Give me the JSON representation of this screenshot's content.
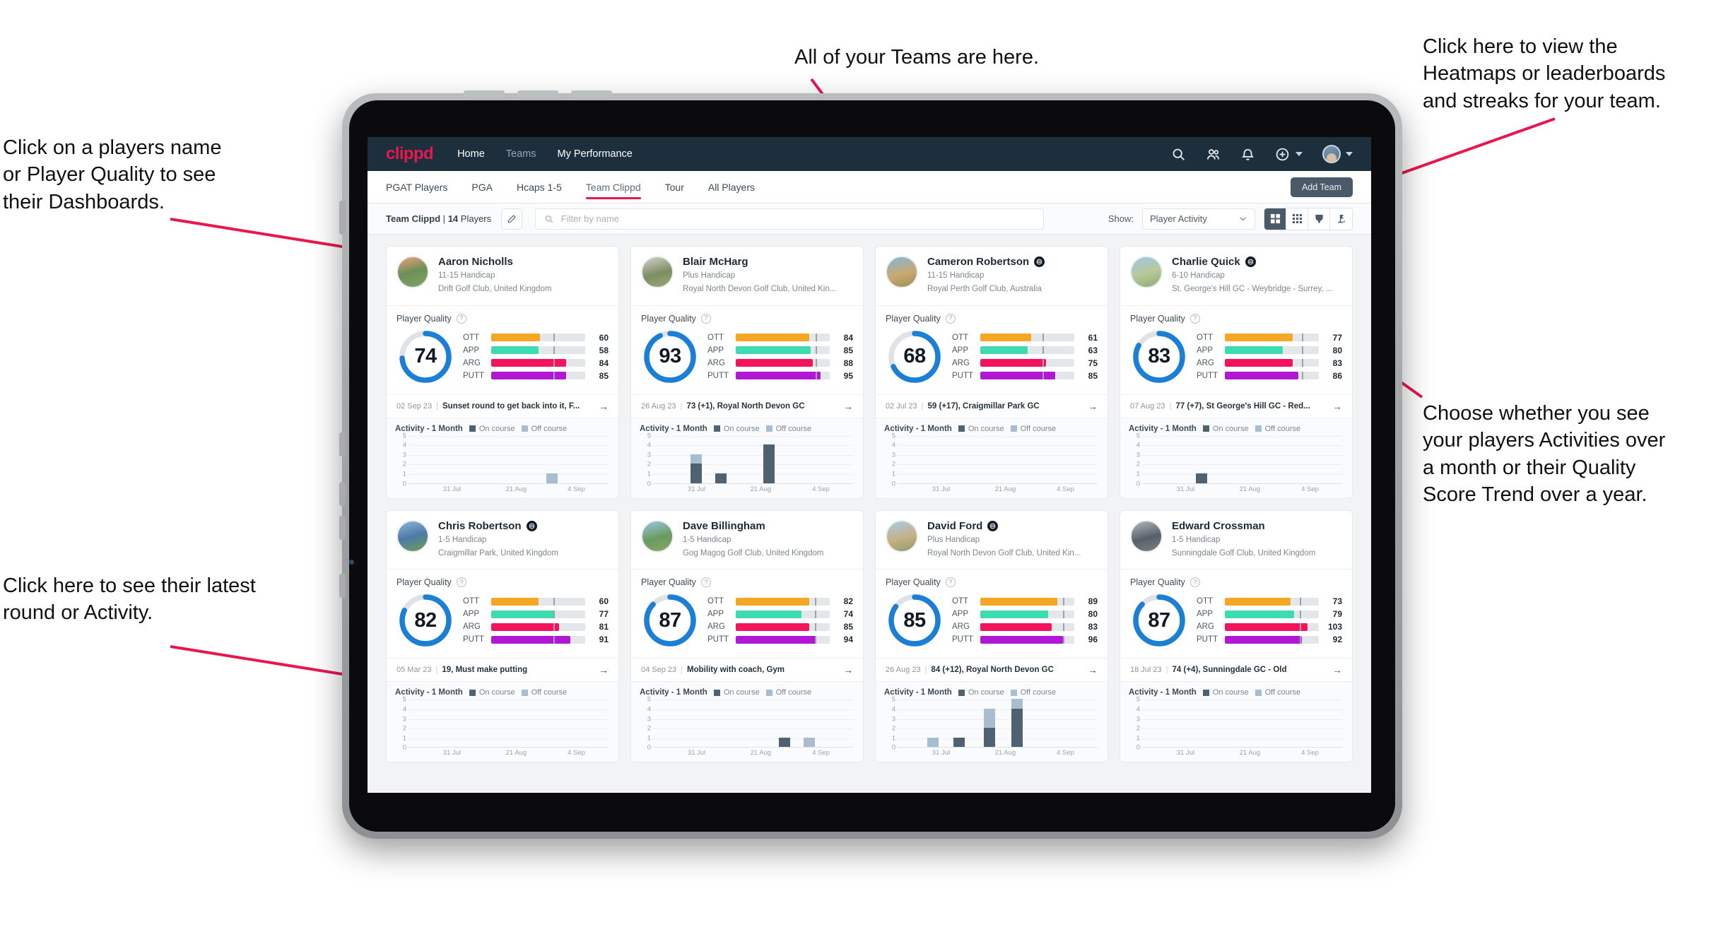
{
  "annotations": [
    {
      "id": "a-teams",
      "text": "All of your Teams are here."
    },
    {
      "id": "a-heatmaps",
      "text": "Click here to view the\nHeatmaps or leaderboards\nand streaks for your team."
    },
    {
      "id": "a-names",
      "text": "Click on a players name\nor Player Quality to see\ntheir Dashboards."
    },
    {
      "id": "a-choose",
      "text": "Choose whether you see\nyour players Activities over\na month or their Quality\nScore Trend over a year."
    },
    {
      "id": "a-latest",
      "text": "Click here to see their latest\nround or Activity."
    }
  ],
  "navbar": {
    "logo": "clippd",
    "links": [
      {
        "label": "Home",
        "active": true
      },
      {
        "label": "Teams",
        "active": false
      },
      {
        "label": "My Performance",
        "active": true
      }
    ],
    "icons": [
      "search-icon",
      "people-icon",
      "bell-icon",
      "plus-circle-icon",
      "chevron-down-icon",
      "avatar"
    ]
  },
  "tabs": [
    {
      "label": "PGAT Players",
      "active": false
    },
    {
      "label": "PGA",
      "active": false
    },
    {
      "label": "Hcaps 1-5",
      "active": false
    },
    {
      "label": "Team Clippd",
      "active": true
    },
    {
      "label": "Tour",
      "active": false
    },
    {
      "label": "All Players",
      "active": false
    }
  ],
  "toolbar": {
    "add_team_label": "Add Team",
    "team_name": "Team Clippd",
    "team_divider": "|",
    "player_count": "14",
    "players_word": "Players",
    "edit_icon": "pencil-icon",
    "search_placeholder": "Filter by name",
    "search_value": "",
    "show_label": "Show:",
    "show_value": "Player Activity",
    "views": [
      {
        "name": "grid-large-view",
        "icon": "grid-4-icon",
        "active": true
      },
      {
        "name": "grid-dense-view",
        "icon": "grid-9-icon",
        "active": false
      },
      {
        "name": "leaderboard-view",
        "icon": "trophy-icon",
        "active": false
      },
      {
        "name": "heatmap-view",
        "icon": "flag-pin-icon",
        "active": false
      }
    ]
  },
  "quality": {
    "title": "Player Quality",
    "help_icon": "question-icon",
    "metric_labels": [
      "OTT",
      "APP",
      "ARG",
      "PUTT"
    ],
    "colors": {
      "OTT": "#f5a623",
      "APP": "#3ddbb0",
      "ARG": "#f4145e",
      "PUTT": "#b317d6",
      "gauge": "#1c7fd6",
      "track": "#e4e7ea"
    }
  },
  "activity": {
    "title": "Activity - 1 Month",
    "legend": [
      {
        "label": "On course",
        "color": "#4f6272"
      },
      {
        "label": "Off course",
        "color": "#a9bdd0"
      }
    ],
    "y_ticks": [
      5,
      4,
      3,
      2,
      1,
      0
    ],
    "x_ticks": [
      "31 Jul",
      "21 Aug",
      "4 Sep"
    ],
    "ymax": 5
  },
  "players": [
    {
      "name": "Aaron Nicholls",
      "verified": false,
      "handicap": "11-15 Handicap",
      "club": "Drift Golf Club, United Kingdom",
      "quality_score": 74,
      "metrics": [
        {
          "label": "OTT",
          "value": 60,
          "fill": 52,
          "tick": 66
        },
        {
          "label": "APP",
          "value": 58,
          "fill": 50,
          "tick": 66
        },
        {
          "label": "ARG",
          "value": 84,
          "fill": 80,
          "tick": 66
        },
        {
          "label": "PUTT",
          "value": 85,
          "fill": 80,
          "tick": 66
        }
      ],
      "latest": {
        "date": "02 Sep 23",
        "text": "Sunset round to get back into it, F..."
      },
      "chart_data": {
        "type": "bar",
        "stacked": true,
        "categories": [
          "31 Jul",
          "21 Aug",
          "4 Sep"
        ],
        "series": [
          {
            "name": "On course",
            "values": [
              0,
              0,
              0
            ]
          },
          {
            "name": "Off course",
            "values": [
              0,
              0,
              1
            ]
          }
        ],
        "bars": [
          {
            "pos": 0.72,
            "on": 0,
            "off": 1
          }
        ],
        "ylim": [
          0,
          5
        ]
      }
    },
    {
      "name": "Blair McHarg",
      "verified": false,
      "handicap": "Plus Handicap",
      "club": "Royal North Devon Golf Club, United Kin...",
      "quality_score": 93,
      "metrics": [
        {
          "label": "OTT",
          "value": 84,
          "fill": 78,
          "tick": 85
        },
        {
          "label": "APP",
          "value": 85,
          "fill": 80,
          "tick": 85
        },
        {
          "label": "ARG",
          "value": 88,
          "fill": 82,
          "tick": 85
        },
        {
          "label": "PUTT",
          "value": 95,
          "fill": 90,
          "tick": 85
        }
      ],
      "latest": {
        "date": "26 Aug 23",
        "text": "73 (+1), Royal North Devon GC"
      },
      "chart_data": {
        "type": "bar",
        "stacked": true,
        "categories": [
          "31 Jul",
          "21 Aug",
          "4 Sep"
        ],
        "series": [
          {
            "name": "On course",
            "values": [
              2,
              1,
              4
            ]
          },
          {
            "name": "Off course",
            "values": [
              1,
              0,
              0
            ]
          }
        ],
        "bars": [
          {
            "pos": 0.22,
            "on": 2,
            "off": 1
          },
          {
            "pos": 0.34,
            "on": 1,
            "off": 0
          },
          {
            "pos": 0.58,
            "on": 4,
            "off": 0
          }
        ],
        "ylim": [
          0,
          5
        ]
      }
    },
    {
      "name": "Cameron Robertson",
      "verified": true,
      "handicap": "11-15 Handicap",
      "club": "Royal Perth Golf Club, Australia",
      "quality_score": 68,
      "metrics": [
        {
          "label": "OTT",
          "value": 61,
          "fill": 54,
          "tick": 66
        },
        {
          "label": "APP",
          "value": 63,
          "fill": 50,
          "tick": 66
        },
        {
          "label": "ARG",
          "value": 75,
          "fill": 70,
          "tick": 66
        },
        {
          "label": "PUTT",
          "value": 85,
          "fill": 80,
          "tick": 66
        }
      ],
      "latest": {
        "date": "02 Jul 23",
        "text": "59 (+17), Craigmillar Park GC"
      },
      "chart_data": {
        "type": "bar",
        "stacked": true,
        "categories": [
          "31 Jul",
          "21 Aug",
          "4 Sep"
        ],
        "series": [
          {
            "name": "On course",
            "values": [
              0,
              0,
              0
            ]
          },
          {
            "name": "Off course",
            "values": [
              0,
              0,
              0
            ]
          }
        ],
        "bars": [],
        "ylim": [
          0,
          5
        ]
      }
    },
    {
      "name": "Charlie Quick",
      "verified": true,
      "handicap": "6-10 Handicap",
      "club": "St. George's Hill GC - Weybridge - Surrey, ...",
      "quality_score": 83,
      "metrics": [
        {
          "label": "OTT",
          "value": 77,
          "fill": 72,
          "tick": 82
        },
        {
          "label": "APP",
          "value": 80,
          "fill": 62,
          "tick": 82
        },
        {
          "label": "ARG",
          "value": 83,
          "fill": 72,
          "tick": 82
        },
        {
          "label": "PUTT",
          "value": 86,
          "fill": 78,
          "tick": 82
        }
      ],
      "latest": {
        "date": "07 Aug 23",
        "text": "77 (+7), St George's Hill GC - Red..."
      },
      "chart_data": {
        "type": "bar",
        "stacked": true,
        "categories": [
          "31 Jul",
          "21 Aug",
          "4 Sep"
        ],
        "series": [
          {
            "name": "On course",
            "values": [
              1,
              0,
              0
            ]
          },
          {
            "name": "Off course",
            "values": [
              0,
              0,
              0
            ]
          }
        ],
        "bars": [
          {
            "pos": 0.3,
            "on": 1,
            "off": 0
          }
        ],
        "ylim": [
          0,
          5
        ]
      }
    },
    {
      "name": "Chris Robertson",
      "verified": true,
      "handicap": "1-5 Handicap",
      "club": "Craigmillar Park, United Kingdom",
      "quality_score": 82,
      "metrics": [
        {
          "label": "OTT",
          "value": 60,
          "fill": 50,
          "tick": 66
        },
        {
          "label": "APP",
          "value": 77,
          "fill": 68,
          "tick": 66
        },
        {
          "label": "ARG",
          "value": 81,
          "fill": 72,
          "tick": 66
        },
        {
          "label": "PUTT",
          "value": 91,
          "fill": 84,
          "tick": 66
        }
      ],
      "latest": {
        "date": "05 Mar 23",
        "text": "19, Must make putting"
      },
      "chart_data": {
        "type": "bar",
        "stacked": true,
        "categories": [
          "31 Jul",
          "21 Aug",
          "4 Sep"
        ],
        "series": [
          {
            "name": "On course",
            "values": [
              0,
              0,
              0
            ]
          },
          {
            "name": "Off course",
            "values": [
              0,
              0,
              0
            ]
          }
        ],
        "bars": [],
        "ylim": [
          0,
          5
        ]
      }
    },
    {
      "name": "Dave Billingham",
      "verified": false,
      "handicap": "1-5 Handicap",
      "club": "Gog Magog Golf Club, United Kingdom",
      "quality_score": 87,
      "metrics": [
        {
          "label": "OTT",
          "value": 82,
          "fill": 78,
          "tick": 84
        },
        {
          "label": "APP",
          "value": 74,
          "fill": 70,
          "tick": 84
        },
        {
          "label": "ARG",
          "value": 85,
          "fill": 78,
          "tick": 84
        },
        {
          "label": "PUTT",
          "value": 94,
          "fill": 86,
          "tick": 84
        }
      ],
      "latest": {
        "date": "04 Sep 23",
        "text": "Mobility with coach, Gym"
      },
      "chart_data": {
        "type": "bar",
        "stacked": true,
        "categories": [
          "31 Jul",
          "21 Aug",
          "4 Sep"
        ],
        "series": [
          {
            "name": "On course",
            "values": [
              0,
              0,
              1
            ]
          },
          {
            "name": "Off course",
            "values": [
              0,
              0,
              1
            ]
          }
        ],
        "bars": [
          {
            "pos": 0.66,
            "on": 1,
            "off": 0
          },
          {
            "pos": 0.78,
            "on": 0,
            "off": 1
          }
        ],
        "ylim": [
          0,
          5
        ]
      }
    },
    {
      "name": "David Ford",
      "verified": true,
      "handicap": "Plus Handicap",
      "club": "Royal North Devon Golf Club, United Kin...",
      "quality_score": 85,
      "metrics": [
        {
          "label": "OTT",
          "value": 89,
          "fill": 82,
          "tick": 88
        },
        {
          "label": "APP",
          "value": 80,
          "fill": 72,
          "tick": 88
        },
        {
          "label": "ARG",
          "value": 83,
          "fill": 76,
          "tick": 88
        },
        {
          "label": "PUTT",
          "value": 96,
          "fill": 88,
          "tick": 88
        }
      ],
      "latest": {
        "date": "26 Aug 23",
        "text": "84 (+12), Royal North Devon GC"
      },
      "chart_data": {
        "type": "bar",
        "stacked": true,
        "categories": [
          "31 Jul",
          "21 Aug",
          "4 Sep"
        ],
        "series": [
          {
            "name": "On course",
            "values": [
              0,
              1,
              2,
              4
            ]
          },
          {
            "name": "Off course",
            "values": [
              1,
              0,
              2,
              1
            ]
          }
        ],
        "bars": [
          {
            "pos": 0.18,
            "on": 0,
            "off": 1
          },
          {
            "pos": 0.31,
            "on": 1,
            "off": 0
          },
          {
            "pos": 0.46,
            "on": 2,
            "off": 2
          },
          {
            "pos": 0.6,
            "on": 4,
            "off": 1
          }
        ],
        "ylim": [
          0,
          5
        ]
      }
    },
    {
      "name": "Edward Crossman",
      "verified": false,
      "handicap": "1-5 Handicap",
      "club": "Sunningdale Golf Club, United Kingdom",
      "quality_score": 87,
      "metrics": [
        {
          "label": "OTT",
          "value": 73,
          "fill": 70,
          "tick": 80
        },
        {
          "label": "APP",
          "value": 79,
          "fill": 74,
          "tick": 80
        },
        {
          "label": "ARG",
          "value": 103,
          "fill": 88,
          "tick": 80
        },
        {
          "label": "PUTT",
          "value": 92,
          "fill": 82,
          "tick": 80
        }
      ],
      "latest": {
        "date": "18 Jul 23",
        "text": "74 (+4), Sunningdale GC - Old"
      },
      "chart_data": {
        "type": "bar",
        "stacked": true,
        "categories": [
          "31 Jul",
          "21 Aug",
          "4 Sep"
        ],
        "series": [
          {
            "name": "On course",
            "values": [
              0,
              0,
              0
            ]
          },
          {
            "name": "Off course",
            "values": [
              0,
              0,
              0
            ]
          }
        ],
        "bars": [],
        "ylim": [
          0,
          5
        ]
      }
    }
  ]
}
